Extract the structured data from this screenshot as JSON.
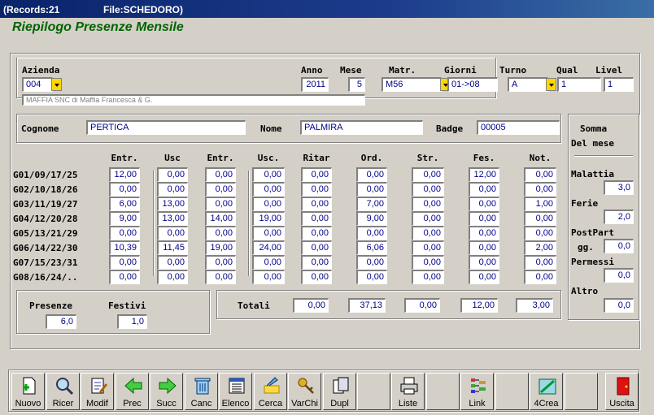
{
  "window": {
    "records": "(Records:21",
    "file": "File:SCHEDORO)"
  },
  "app_title": "Riepilogo Presenze Mensile",
  "header": {
    "azienda_label": "Azienda",
    "azienda_value": "004",
    "azienda_desc": "MAFFIA SNC di Maffia Francesca & G.",
    "anno_label": "Anno",
    "anno_value": "2011",
    "mese_label": "Mese",
    "mese_value": "5",
    "matr_label": "Matr.",
    "matr_value": "M56",
    "giorni_label": "Giorni",
    "giorni_value": "01->08",
    "turno_label": "Turno",
    "turno_value": "A",
    "qual_label": "Qual",
    "qual_value": "1",
    "livel_label": "Livel",
    "livel_value": "1"
  },
  "person": {
    "cognome_label": "Cognome",
    "cognome_value": "PERTICA",
    "nome_label": "Nome",
    "nome_value": "PALMIRA",
    "badge_label": "Badge",
    "badge_value": "00005"
  },
  "grid": {
    "columns": [
      "Entr.",
      "Usc",
      "Entr.",
      "Usc.",
      "Ritar",
      "Ord.",
      "Str.",
      "Fes.",
      "Not."
    ],
    "rows": [
      {
        "label": "G01/09/17/25",
        "values": [
          "12,00",
          "0,00",
          "0,00",
          "0,00",
          "0,00",
          "0,00",
          "0,00",
          "12,00",
          "0,00"
        ]
      },
      {
        "label": "G02/10/18/26",
        "values": [
          "0,00",
          "0,00",
          "0,00",
          "0,00",
          "0,00",
          "0,00",
          "0,00",
          "0,00",
          "0,00"
        ]
      },
      {
        "label": "G03/11/19/27",
        "values": [
          "6,00",
          "13,00",
          "0,00",
          "0,00",
          "0,00",
          "7,00",
          "0,00",
          "0,00",
          "1,00"
        ]
      },
      {
        "label": "G04/12/20/28",
        "values": [
          "9,00",
          "13,00",
          "14,00",
          "19,00",
          "0,00",
          "9,00",
          "0,00",
          "0,00",
          "0,00"
        ]
      },
      {
        "label": "G05/13/21/29",
        "values": [
          "0,00",
          "0,00",
          "0,00",
          "0,00",
          "0,00",
          "0,00",
          "0,00",
          "0,00",
          "0,00"
        ]
      },
      {
        "label": "G06/14/22/30",
        "values": [
          "10,39",
          "11,45",
          "19,00",
          "24,00",
          "0,00",
          "6,06",
          "0,00",
          "0,00",
          "2,00"
        ]
      },
      {
        "label": "G07/15/23/31",
        "values": [
          "0,00",
          "0,00",
          "0,00",
          "0,00",
          "0,00",
          "0,00",
          "0,00",
          "0,00",
          "0,00"
        ]
      },
      {
        "label": "G08/16/24/..",
        "values": [
          "0,00",
          "0,00",
          "0,00",
          "0,00",
          "0,00",
          "0,00",
          "0,00",
          "0,00",
          "0,00"
        ]
      }
    ]
  },
  "summary": {
    "presenze_label": "Presenze",
    "presenze_value": "6,0",
    "festivi_label": "Festivi",
    "festivi_value": "1,0",
    "totali_label": "Totali",
    "totali": [
      "0,00",
      "37,13",
      "0,00",
      "12,00",
      "3,00"
    ]
  },
  "side": {
    "title1": "Somma",
    "title2": "Del mese",
    "malattia_label": "Malattia",
    "malattia_value": "3,0",
    "ferie_label": "Ferie",
    "ferie_value": "2,0",
    "postpart_label": "PostPart",
    "gg_label": "gg.",
    "postpart_value": "0,0",
    "permessi_label": "Permessi",
    "permessi_value": "0,0",
    "altro_label": "Altro",
    "altro_value": "0,0"
  },
  "toolbar": [
    {
      "label": "Nuovo",
      "icon": "new-doc-icon"
    },
    {
      "label": "Ricer",
      "icon": "search-icon"
    },
    {
      "label": "Modif",
      "icon": "edit-icon"
    },
    {
      "label": "Prec",
      "icon": "arrow-left-icon"
    },
    {
      "label": "Succ",
      "icon": "arrow-right-icon"
    },
    {
      "label": "Canc",
      "icon": "trash-icon"
    },
    {
      "label": "Elenco",
      "icon": "list-icon"
    },
    {
      "label": "Cerca",
      "icon": "find-icon"
    },
    {
      "label": "VarChi",
      "icon": "keys-icon"
    },
    {
      "label": "Dupl",
      "icon": "duplicate-icon"
    },
    {
      "label": "",
      "icon": ""
    },
    {
      "label": "Liste",
      "icon": "printer-icon"
    },
    {
      "label": "",
      "icon": ""
    },
    {
      "label": "Link",
      "icon": "link-icon"
    },
    {
      "label": "",
      "icon": ""
    },
    {
      "label": "4Crea",
      "icon": "create-icon"
    },
    {
      "label": "",
      "icon": ""
    },
    {
      "label": "Uscita",
      "icon": "exit-door-icon"
    }
  ],
  "colors": {
    "title_bar": "#0a246a",
    "app_title": "#006400",
    "field_text": "#00008b",
    "dropdown": "#ffd700"
  }
}
